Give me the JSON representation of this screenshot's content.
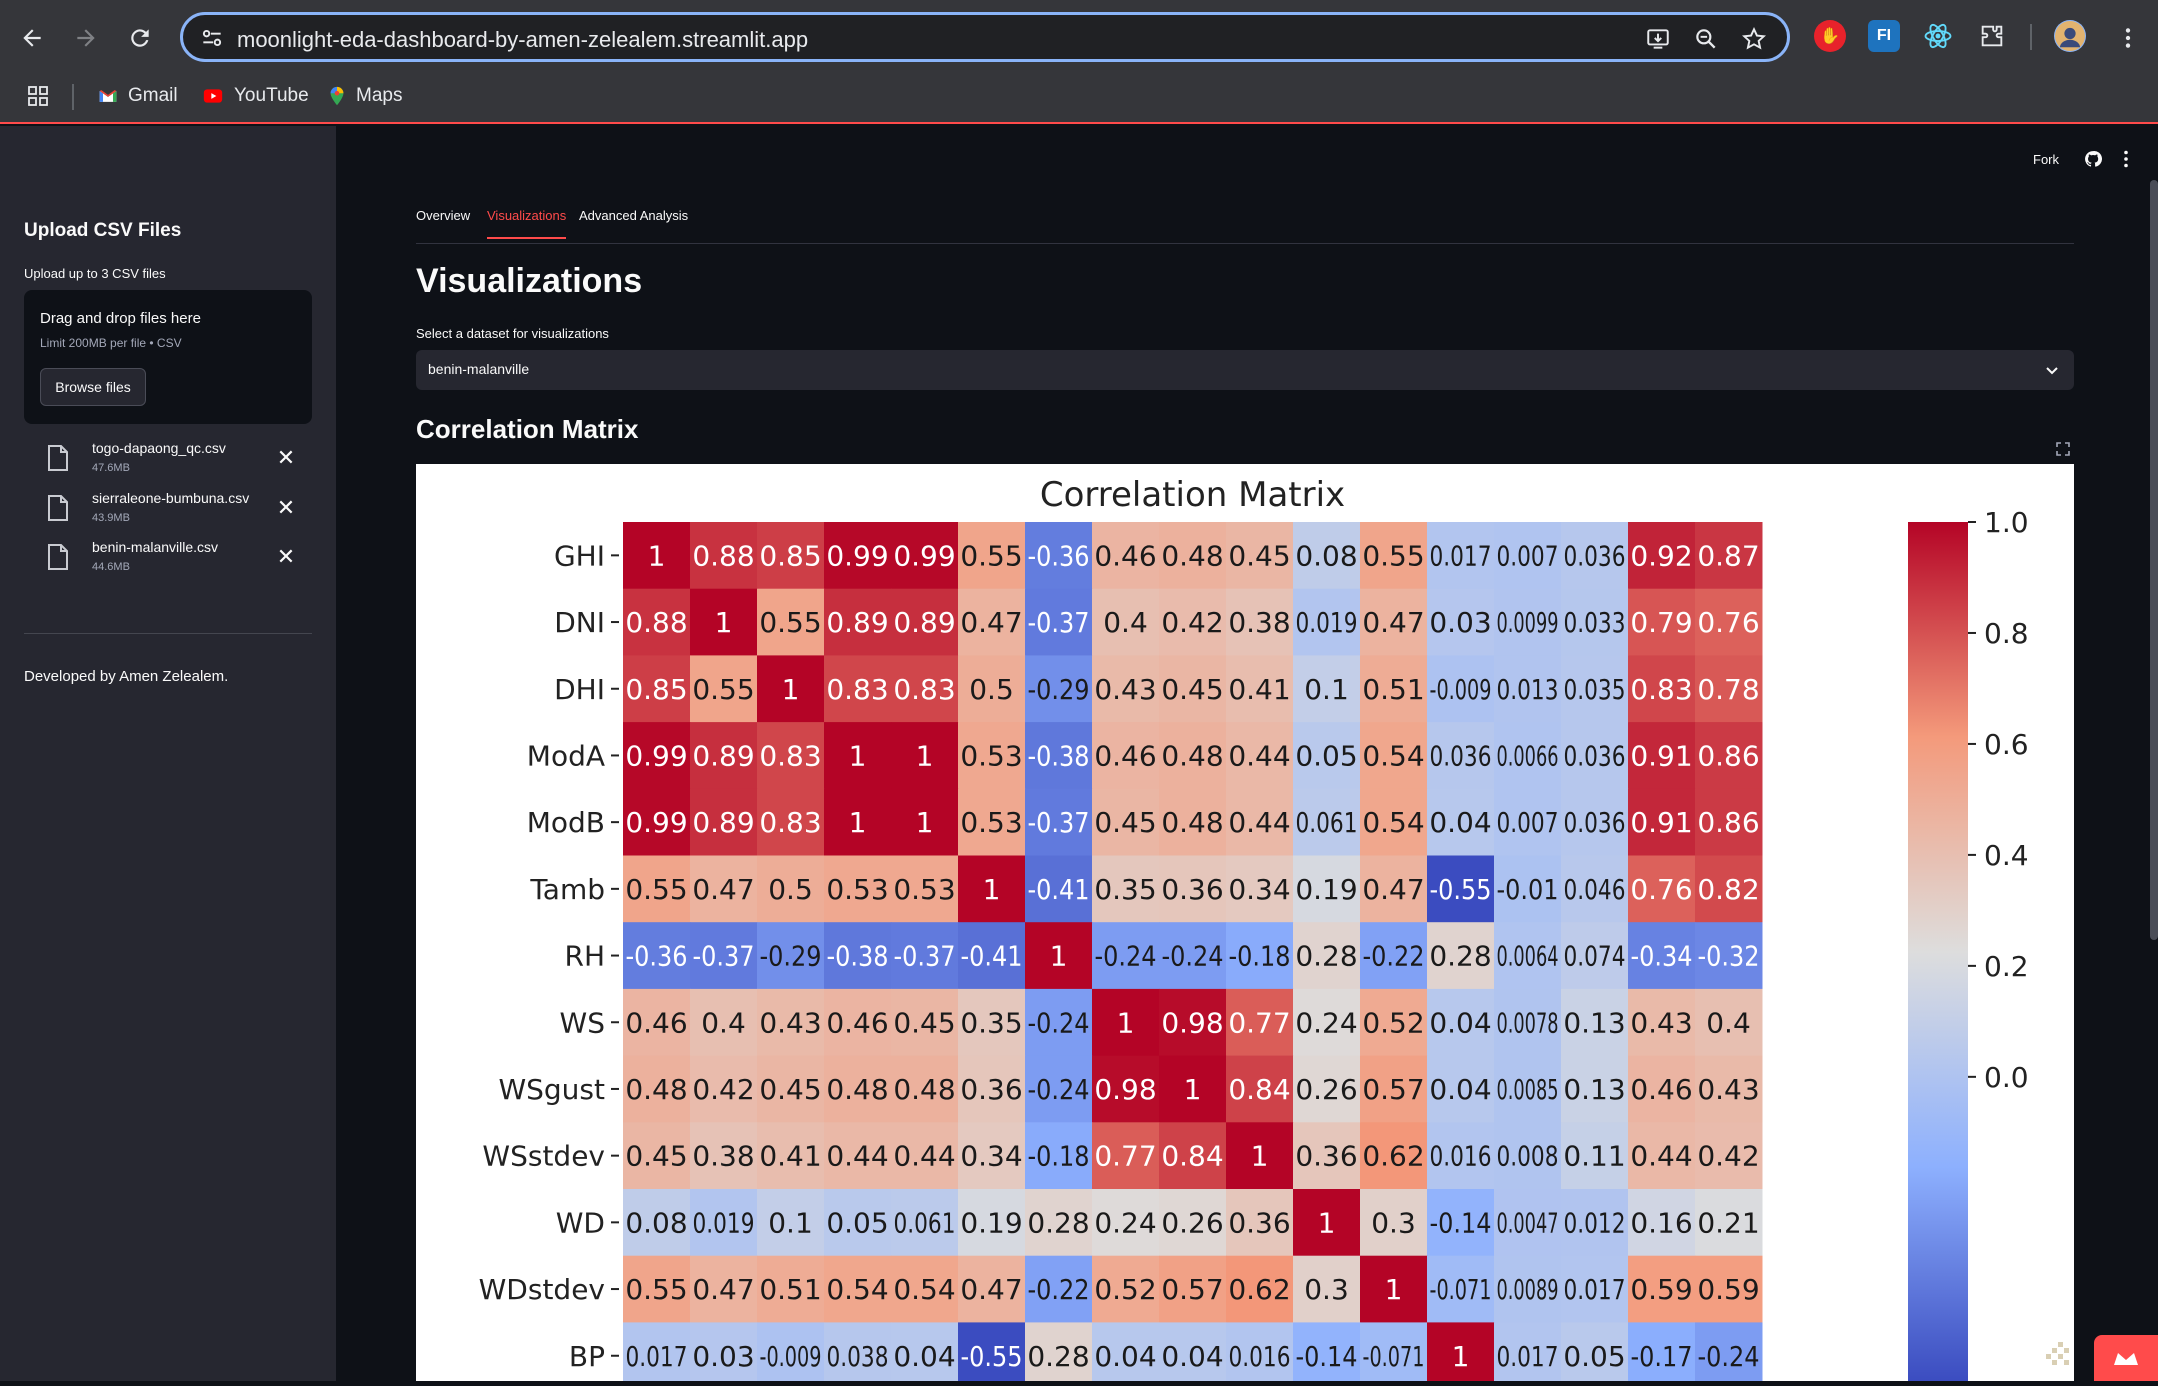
{
  "browser": {
    "url": "moonlight-eda-dashboard-by-amen-zelealem.streamlit.app",
    "bookmarks": [
      "Gmail",
      "YouTube",
      "Maps"
    ],
    "extensions": [
      {
        "name": "adblock-icon",
        "label": "",
        "color": "#e8222b"
      },
      {
        "name": "fl-icon",
        "label": "FI",
        "color": "#1e73be"
      },
      {
        "name": "react-icon",
        "label": "",
        "color": "#2b2d31"
      }
    ]
  },
  "sidebar": {
    "title": "Upload CSV Files",
    "subtitle": "Upload up to 3 CSV files",
    "dropzone": {
      "title": "Drag and drop files here",
      "limit": "Limit 200MB per file • CSV",
      "browse_label": "Browse files"
    },
    "files": [
      {
        "name": "togo-dapaong_qc.csv",
        "size": "47.6MB"
      },
      {
        "name": "sierraleone-bumbuna.csv",
        "size": "43.9MB"
      },
      {
        "name": "benin-malanville.csv",
        "size": "44.6MB"
      }
    ],
    "footer": "Developed by Amen Zelealem."
  },
  "header": {
    "fork_label": "Fork"
  },
  "tabs": [
    {
      "label": "Overview",
      "active": false
    },
    {
      "label": "Visualizations",
      "active": true
    },
    {
      "label": "Advanced Analysis",
      "active": false
    }
  ],
  "main": {
    "title": "Visualizations",
    "select_label": "Select a dataset for visualizations",
    "selected_dataset": "benin-malanville",
    "section_heading": "Correlation Matrix"
  },
  "chart_data": {
    "type": "heatmap",
    "title": "Correlation Matrix",
    "rows": [
      "GHI",
      "DNI",
      "DHI",
      "ModA",
      "ModB",
      "Tamb",
      "RH",
      "WS",
      "WSgust",
      "WSstdev",
      "WD",
      "WDstdev",
      "BP"
    ],
    "columns_visible": 17,
    "values": [
      [
        "1",
        "0.88",
        "0.85",
        "0.99",
        "0.99",
        "0.55",
        "-0.36",
        "0.46",
        "0.48",
        "0.45",
        "0.08",
        "0.55",
        "0.017",
        "0.007",
        "0.036",
        "0.92",
        "0.87"
      ],
      [
        "0.88",
        "1",
        "0.55",
        "0.89",
        "0.89",
        "0.47",
        "-0.37",
        "0.4",
        "0.42",
        "0.38",
        "0.019",
        "0.47",
        "0.03",
        "0.0099",
        "0.033",
        "0.79",
        "0.76"
      ],
      [
        "0.85",
        "0.55",
        "1",
        "0.83",
        "0.83",
        "0.5",
        "-0.29",
        "0.43",
        "0.45",
        "0.41",
        "0.1",
        "0.51",
        "-0.009",
        "0.013",
        "0.035",
        "0.83",
        "0.78"
      ],
      [
        "0.99",
        "0.89",
        "0.83",
        "1",
        "1",
        "0.53",
        "-0.38",
        "0.46",
        "0.48",
        "0.44",
        "0.05",
        "0.54",
        "0.036",
        "0.0066",
        "0.036",
        "0.91",
        "0.86"
      ],
      [
        "0.99",
        "0.89",
        "0.83",
        "1",
        "1",
        "0.53",
        "-0.37",
        "0.45",
        "0.48",
        "0.44",
        "0.061",
        "0.54",
        "0.04",
        "0.007",
        "0.036",
        "0.91",
        "0.86"
      ],
      [
        "0.55",
        "0.47",
        "0.5",
        "0.53",
        "0.53",
        "1",
        "-0.41",
        "0.35",
        "0.36",
        "0.34",
        "0.19",
        "0.47",
        "-0.55",
        "-0.01",
        "0.046",
        "0.76",
        "0.82"
      ],
      [
        "-0.36",
        "-0.37",
        "-0.29",
        "-0.38",
        "-0.37",
        "-0.41",
        "1",
        "-0.24",
        "-0.24",
        "-0.18",
        "0.28",
        "-0.22",
        "0.28",
        "0.0064",
        "0.074",
        "-0.34",
        "-0.32"
      ],
      [
        "0.46",
        "0.4",
        "0.43",
        "0.46",
        "0.45",
        "0.35",
        "-0.24",
        "1",
        "0.98",
        "0.77",
        "0.24",
        "0.52",
        "0.04",
        "0.0078",
        "0.13",
        "0.43",
        "0.4"
      ],
      [
        "0.48",
        "0.42",
        "0.45",
        "0.48",
        "0.48",
        "0.36",
        "-0.24",
        "0.98",
        "1",
        "0.84",
        "0.26",
        "0.57",
        "0.04",
        "0.0085",
        "0.13",
        "0.46",
        "0.43"
      ],
      [
        "0.45",
        "0.38",
        "0.41",
        "0.44",
        "0.44",
        "0.34",
        "-0.18",
        "0.77",
        "0.84",
        "1",
        "0.36",
        "0.62",
        "0.016",
        "0.008",
        "0.11",
        "0.44",
        "0.42"
      ],
      [
        "0.08",
        "0.019",
        "0.1",
        "0.05",
        "0.061",
        "0.19",
        "0.28",
        "0.24",
        "0.26",
        "0.36",
        "1",
        "0.3",
        "-0.14",
        "0.0047",
        "0.012",
        "0.16",
        "0.21"
      ],
      [
        "0.55",
        "0.47",
        "0.51",
        "0.54",
        "0.54",
        "0.47",
        "-0.22",
        "0.52",
        "0.57",
        "0.62",
        "0.3",
        "1",
        "-0.071",
        "0.0089",
        "0.017",
        "0.59",
        "0.59"
      ],
      [
        "0.017",
        "0.03",
        "-0.009",
        "0.038",
        "0.04",
        "-0.55",
        "0.28",
        "0.04",
        "0.04",
        "0.016",
        "-0.14",
        "-0.071",
        "1",
        "0.017",
        "0.05",
        "-0.17",
        "-0.24"
      ]
    ],
    "colorbar_ticks": [
      "1.0",
      "0.8",
      "0.6",
      "0.4",
      "0.2",
      "0.0"
    ],
    "colorbar_range": [
      -0.55,
      1.0
    ],
    "colormap": "coolwarm"
  }
}
